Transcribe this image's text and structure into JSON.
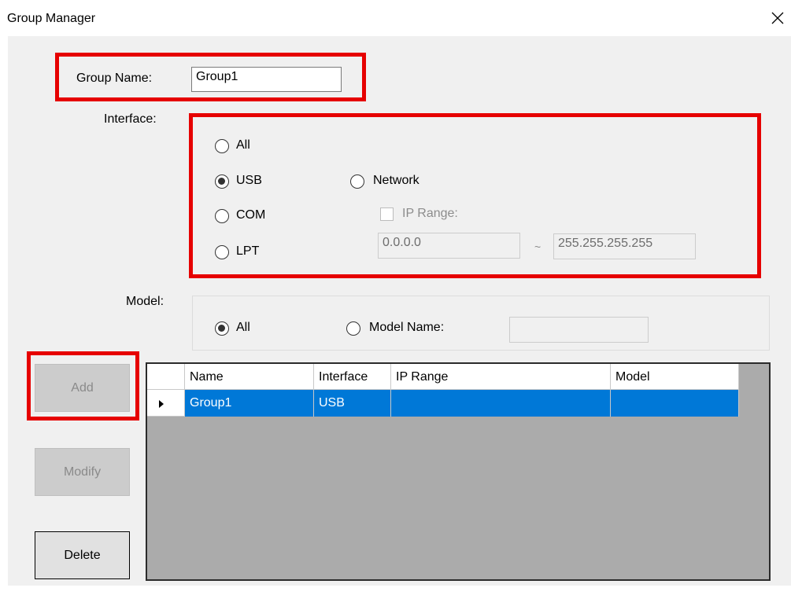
{
  "window": {
    "title": "Group Manager"
  },
  "group_name": {
    "label": "Group Name:",
    "value": "Group1"
  },
  "interface": {
    "label": "Interface:",
    "options": {
      "all": "All",
      "usb": "USB",
      "com": "COM",
      "lpt": "LPT",
      "network": "Network"
    },
    "selected": "USB",
    "ip_range_label": "IP Range:",
    "ip_from": "0.0.0.0",
    "ip_separator": "~",
    "ip_to": "255.255.255.255"
  },
  "model": {
    "label": "Model:",
    "all_label": "All",
    "model_name_label": "Model Name:",
    "selected": "All",
    "model_name_value": ""
  },
  "buttons": {
    "add": "Add",
    "modify": "Modify",
    "delete": "Delete"
  },
  "grid": {
    "columns": [
      "Name",
      "Interface",
      "IP Range",
      "Model"
    ],
    "rows": [
      {
        "name": "Group1",
        "interface": "USB",
        "ip_range": "",
        "model": ""
      }
    ]
  },
  "colors": {
    "highlight_box": "#e60000",
    "selected_row": "#0078d7",
    "grid_background": "#ababab"
  }
}
